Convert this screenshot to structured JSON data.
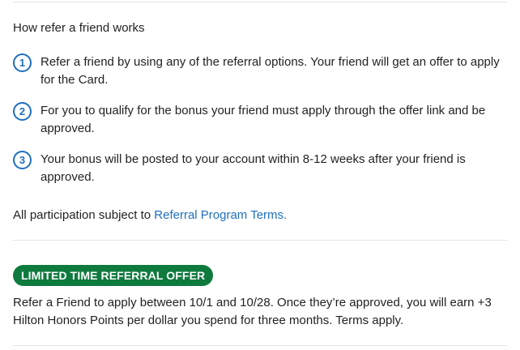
{
  "how_it_works": {
    "heading": "How refer a friend works",
    "steps": [
      {
        "number": "1",
        "text": "Refer a friend by using any of the referral options. Your friend will get an offer to apply for the Card."
      },
      {
        "number": "2",
        "text": "For you to qualify for the bonus your friend must apply through the offer link and be approved."
      },
      {
        "number": "3",
        "text": "Your bonus will be posted to your account within 8-12 weeks after your friend is approved."
      }
    ]
  },
  "participation": {
    "prefix": "All participation subject to ",
    "link_label": "Referral Program Terms."
  },
  "offer": {
    "badge": "LIMITED TIME REFERRAL OFFER",
    "text": "Refer a Friend to apply between 10/1 and 10/28. Once they’re approved, you will earn +3 Hilton Honors Points per dollar you spend for three months. Terms apply."
  },
  "colors": {
    "accent_blue": "#1f6fbf",
    "badge_green": "#0e7a3e",
    "divider": "#e3e3e3",
    "text": "#222222"
  }
}
